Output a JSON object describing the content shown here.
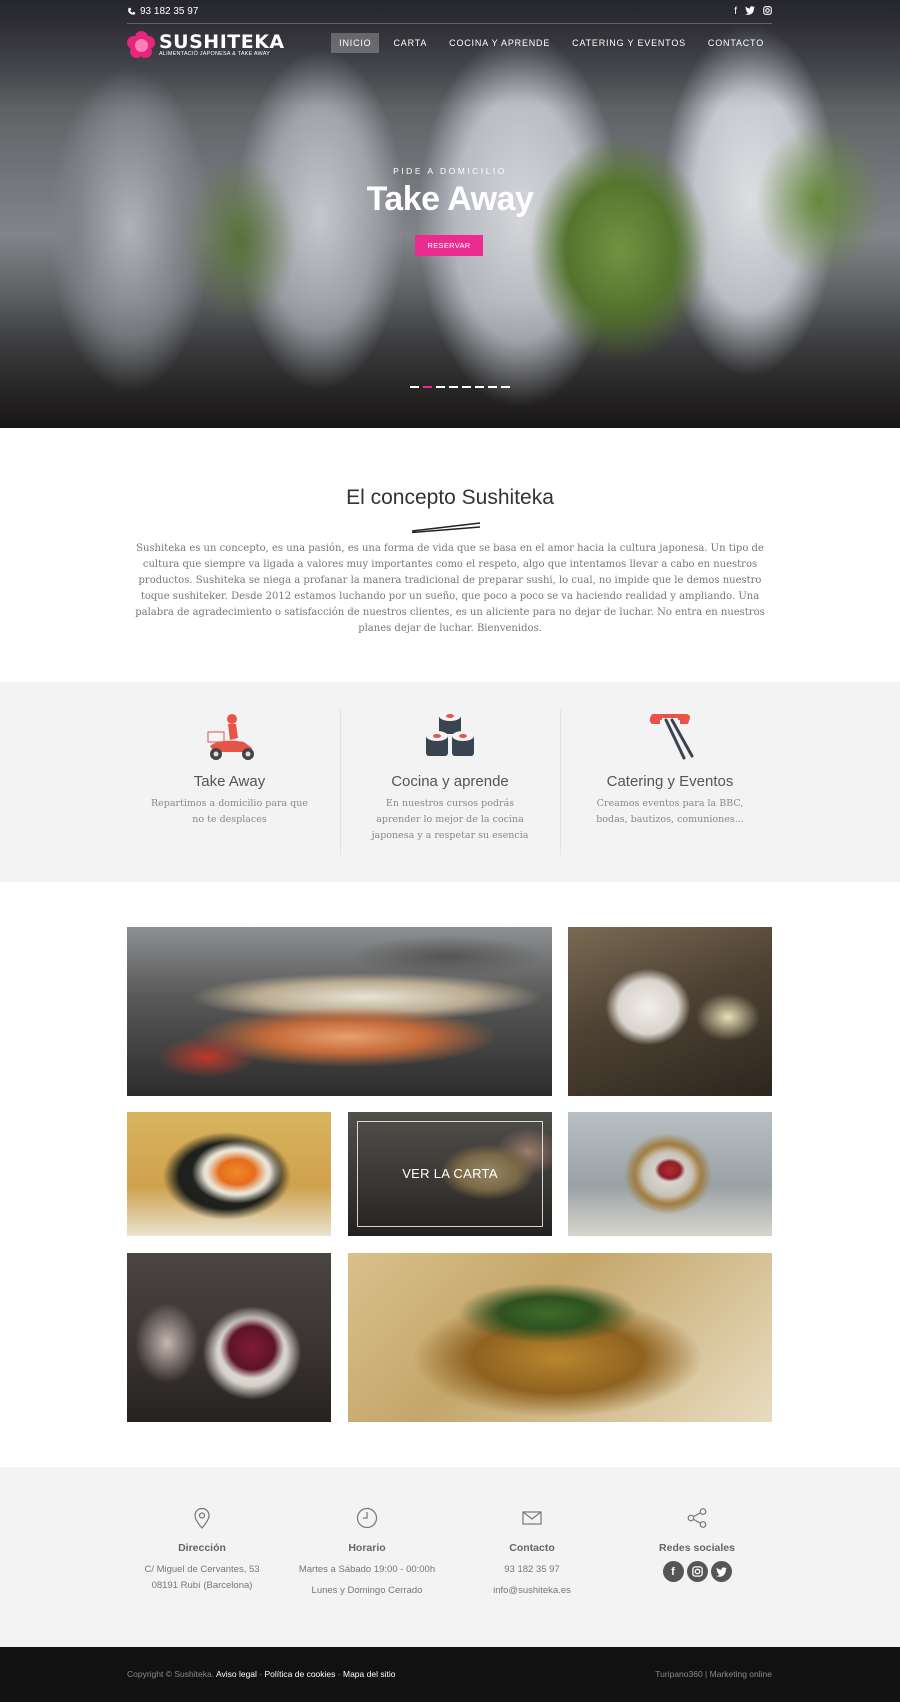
{
  "header": {
    "phone": "93 182 35 97",
    "social_icons": [
      "facebook-icon",
      "twitter-icon",
      "instagram-icon"
    ],
    "logo_brand": "SUSHITEKA",
    "logo_tagline": "ALIMENTACIÓ JAPONESA & TAKE AWAY",
    "nav": [
      {
        "label": "INICIO",
        "active": true
      },
      {
        "label": "CARTA"
      },
      {
        "label": "COCINA Y APRENDE"
      },
      {
        "label": "CATERING Y EVENTOS"
      },
      {
        "label": "CONTACTO"
      }
    ]
  },
  "hero": {
    "subtitle": "PIDE A DOMICILIO",
    "title": "Take Away",
    "button": "RESERVAR",
    "slides": 8,
    "active_slide": 2
  },
  "concept": {
    "title": "El concepto Sushiteka",
    "text": "Sushiteka es un concepto, es una pasión, es una forma de vida que se basa en el amor hacia la cultura japonesa. Un tipo de cultura que siempre va ligada a valores muy importantes como el respeto, algo que intentamos llevar a cabo en nuestros productos. Sushiteka se niega a profanar la manera tradicional de preparar sushi, lo cual, no impide que le demos nuestro toque sushiteker. Desde 2012 estamos luchando por un sueño, que poco a poco se va haciendo realidad y ampliando. Una palabra de agradecimiento o satisfacción de nuestros clientes, es un aliciente para no dejar de luchar. No entra en nuestros planes dejar de luchar. Bienvenidos."
  },
  "services": [
    {
      "icon": "scooter-delivery-icon",
      "title": "Take Away",
      "text": "Repartimos a domicilio para que no te desplaces"
    },
    {
      "icon": "sushi-rolls-icon",
      "title": "Cocina y aprende",
      "text": "En nuestros cursos podrás aprender lo mejor de la cocina japonesa y a respetar su esencia"
    },
    {
      "icon": "chopsticks-icon",
      "title": "Catering y Eventos",
      "text": "Creamos eventos para la BBC, bodas, bautizos, comuniones..."
    }
  ],
  "gallery": {
    "cta": "VER LA CARTA"
  },
  "info": {
    "address": {
      "title": "Dirección",
      "line1": "C/ Miguel de Cervantes, 53",
      "line2": "08191 Rubí (Barcelona)"
    },
    "hours": {
      "title": "Horario",
      "line1": "Martes a Sábado 19:00 - 00:00h",
      "line2": "Lunes y Domingo Cerrado"
    },
    "contact": {
      "title": "Contacto",
      "phone": "93 182 35 97",
      "email": "info@sushiteka.es"
    },
    "social": {
      "title": "Redes sociales",
      "icons": [
        "facebook-icon",
        "instagram-icon",
        "twitter-icon"
      ]
    }
  },
  "footer": {
    "copyright": "Copyright © Sushiteka.",
    "legal": "Aviso legal",
    "sep1": "-",
    "cookies": "Política de cookies",
    "sep2": "-",
    "sitemap": "Mapa del sitio",
    "credit": "Turipano360 | Marketing online"
  },
  "colors": {
    "accent": "#ea2b8f",
    "footer_bg": "#111111",
    "section_bg": "#f3f3f3"
  }
}
